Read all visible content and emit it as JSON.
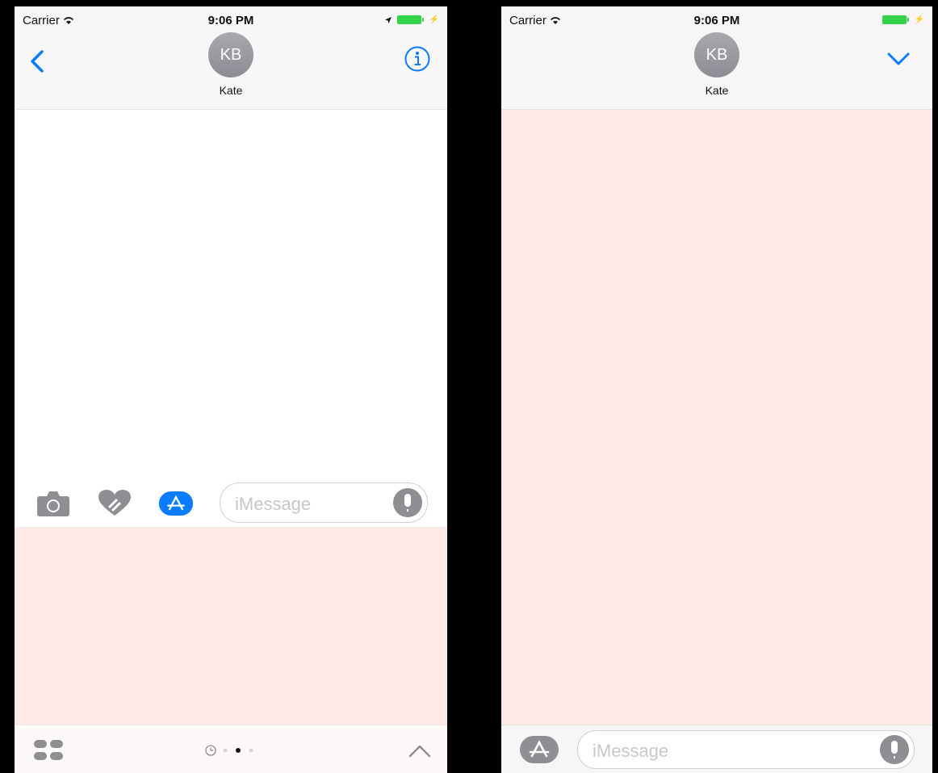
{
  "left_screen": {
    "status": {
      "carrier": "Carrier",
      "time": "9:06 PM"
    },
    "header": {
      "avatar_initials": "KB",
      "contact_name": "Kate"
    },
    "input": {
      "placeholder": "iMessage"
    }
  },
  "right_screen": {
    "status": {
      "carrier": "Carrier",
      "time": "9:06 PM"
    },
    "header": {
      "avatar_initials": "KB",
      "contact_name": "Kate"
    },
    "input": {
      "placeholder": "iMessage"
    }
  },
  "colors": {
    "accent": "#0a7cff",
    "drawer_background": "#fdeae7",
    "battery": "#32d34a",
    "icon_gray": "#8e8e93"
  },
  "icons": {
    "back": "chevron-left-icon",
    "info": "info-icon",
    "collapse": "chevron-down-icon",
    "camera": "camera-icon",
    "digital_touch": "heart-icon",
    "app_store": "app-store-icon",
    "mic": "microphone-icon",
    "app_grid": "grid-icon",
    "expand": "chevron-up-icon"
  }
}
